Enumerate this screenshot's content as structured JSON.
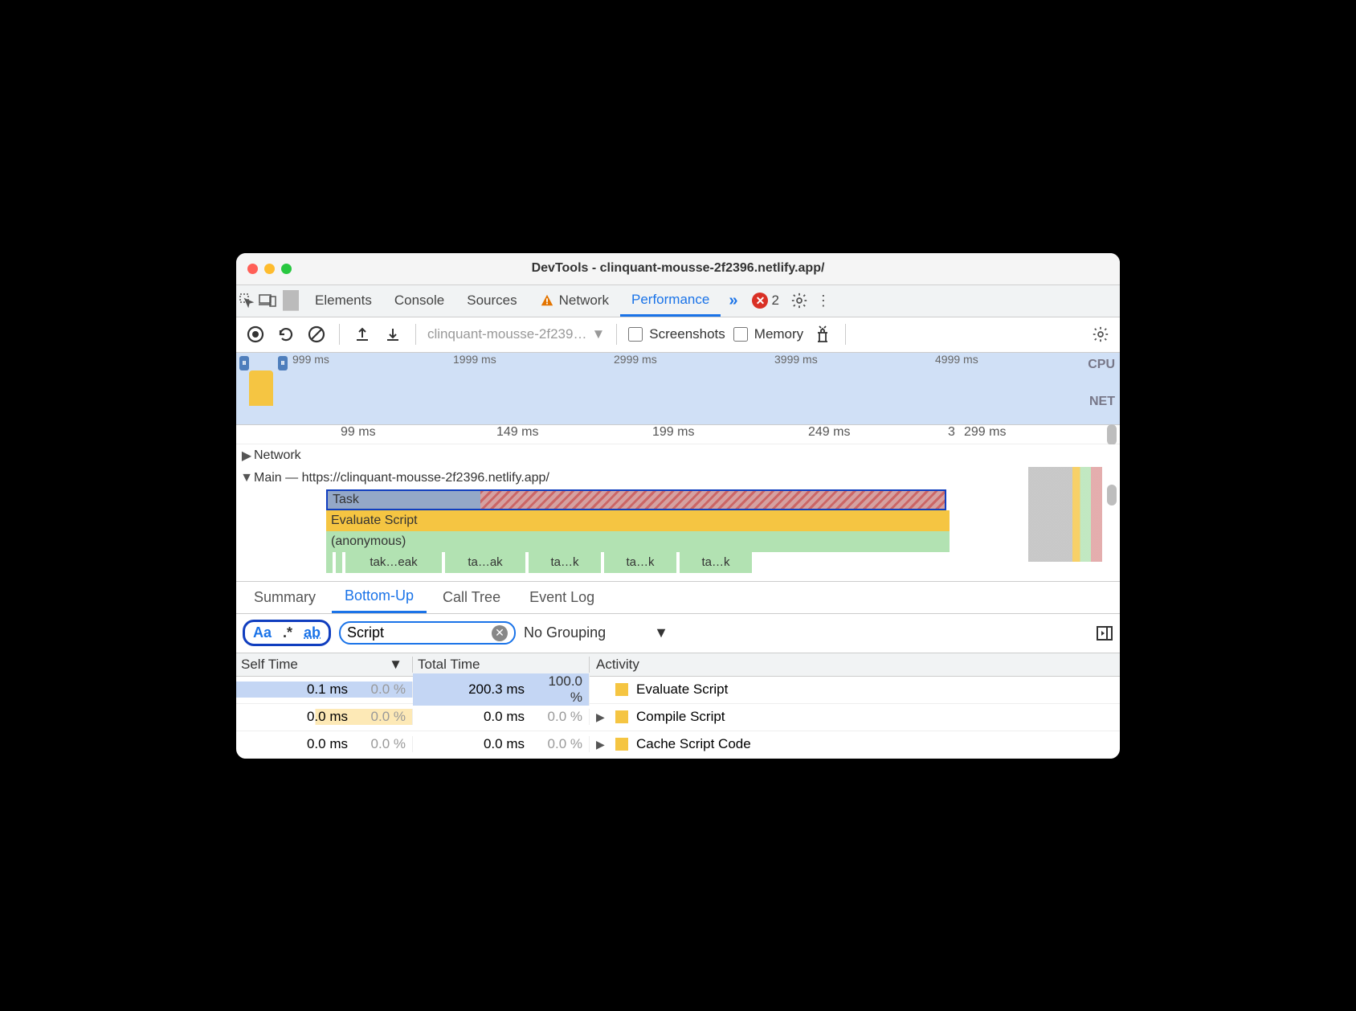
{
  "window": {
    "title": "DevTools - clinquant-mousse-2f2396.netlify.app/"
  },
  "tabs": {
    "items": [
      "Elements",
      "Console",
      "Sources",
      "Network",
      "Performance"
    ],
    "active": "Performance",
    "warning_on": "Network",
    "error_count": "2"
  },
  "toolbar": {
    "profile_select": "clinquant-mousse-2f239…",
    "screenshots_label": "Screenshots",
    "screenshots_checked": false,
    "memory_label": "Memory",
    "memory_checked": false
  },
  "overview": {
    "ticks": [
      "999 ms",
      "1999 ms",
      "2999 ms",
      "3999 ms",
      "4999 ms"
    ],
    "right_labels": [
      "CPU",
      "NET"
    ]
  },
  "ruler2": {
    "ticks": [
      "99 ms",
      "149 ms",
      "199 ms",
      "249 ms",
      "299 ms"
    ],
    "last": "3"
  },
  "flame": {
    "network_label": "Network",
    "main_label": "Main — https://clinquant-mousse-2f2396.netlify.app/",
    "task_label": "Task",
    "eval_label": "Evaluate Script",
    "anon_label": "(anonymous)",
    "leaves": [
      "tak…eak",
      "ta…ak",
      "ta…k",
      "ta…k",
      "ta…k"
    ]
  },
  "bottom_tabs": {
    "items": [
      "Summary",
      "Bottom-Up",
      "Call Tree",
      "Event Log"
    ],
    "active": "Bottom-Up"
  },
  "filterbar": {
    "options": [
      "Aa",
      ".*",
      "ab"
    ],
    "search_value": "Script",
    "grouping": "No Grouping"
  },
  "table": {
    "headers": {
      "self": "Self Time",
      "total": "Total Time",
      "activity": "Activity"
    },
    "rows": [
      {
        "self_ms": "0.1 ms",
        "self_pct": "0.0 %",
        "total_ms": "200.3 ms",
        "total_pct": "100.0 %",
        "activity": "Evaluate Script",
        "expandable": false
      },
      {
        "self_ms": "0.0 ms",
        "self_pct": "0.0 %",
        "total_ms": "0.0 ms",
        "total_pct": "0.0 %",
        "activity": "Compile Script",
        "expandable": true
      },
      {
        "self_ms": "0.0 ms",
        "self_pct": "0.0 %",
        "total_ms": "0.0 ms",
        "total_pct": "0.0 %",
        "activity": "Cache Script Code",
        "expandable": true
      }
    ]
  }
}
